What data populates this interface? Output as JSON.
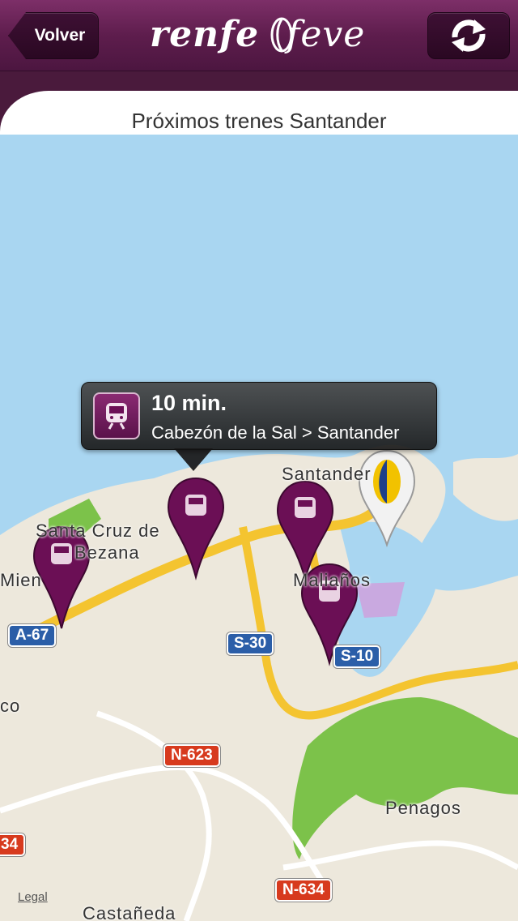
{
  "navbar": {
    "back_label": "Volver",
    "logo_text": "renfe",
    "logo_text2": "feve",
    "refresh_icon": "refresh-icon"
  },
  "title": "Próximos trenes Santander",
  "callout": {
    "time": "10 min.",
    "route": "Cabezón de la Sal > Santander",
    "icon": "train-icon"
  },
  "map": {
    "labels": [
      "Santander",
      "Santa Cruz de",
      "Bezana",
      "Mien",
      "Maliaños",
      "co",
      "Penagos",
      "Castañeda"
    ],
    "shields": [
      "A-67",
      "S-30",
      "S-10",
      "N-623",
      "N-634",
      "34"
    ],
    "legal": "Legal"
  },
  "colors": {
    "nav": "#5e1d4d",
    "pin": "#6b0f55",
    "sea": "#a9d6f1",
    "land": "#ede8dc",
    "road": "#f4c430",
    "park": "#7cc24a"
  }
}
